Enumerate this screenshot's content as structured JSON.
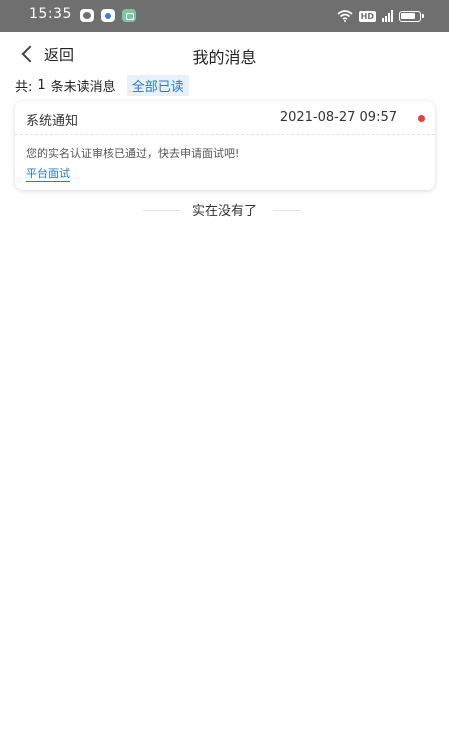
{
  "status_bar": {
    "time": "15:35",
    "hd_label": "HD",
    "apps": [
      "chat-app-icon",
      "browser-app-icon",
      "wallet-app-icon"
    ]
  },
  "nav": {
    "back_label": "返回",
    "title": "我的消息"
  },
  "summary": {
    "prefix": "共:",
    "count": "1",
    "suffix": "条未读消息",
    "mark_all_read": "全部已读"
  },
  "messages": [
    {
      "type": "系统通知",
      "time": "2021-08-27 09:57",
      "unread": true,
      "content": "您的实名认证审核已通过，快去申请面试吧!",
      "link_label": "平台面试"
    }
  ],
  "list_end_text": "实在没有了",
  "colors": {
    "status_bar_bg": "#6f6f6f",
    "accent": "#2b78c2",
    "accent_bg": "#e8f1fa",
    "unread_dot": "#e04040"
  }
}
